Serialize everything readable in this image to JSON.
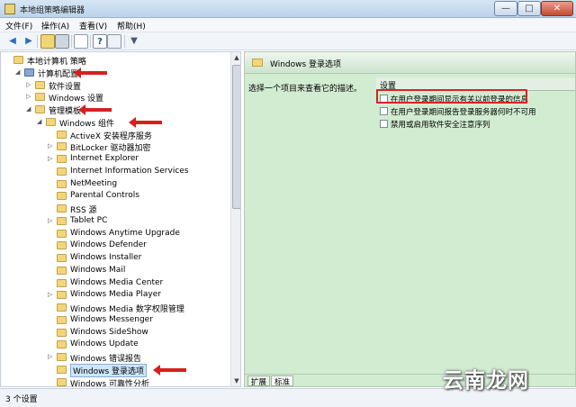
{
  "window": {
    "title": "本地组策略编辑器",
    "min_symbol": "—",
    "max_symbol": "□",
    "close_symbol": "✕"
  },
  "menu": [
    "文件(F)",
    "操作(A)",
    "查看(V)",
    "帮助(H)"
  ],
  "toolbar": {
    "back_icon": "arrow-left-icon",
    "forward_icon": "arrow-right-icon",
    "filter_symbol": "▼"
  },
  "tree": [
    {
      "label": "本地计算机 策略",
      "indent": 0,
      "expander": "",
      "icon": "policy"
    },
    {
      "label": "计算机配置",
      "indent": 1,
      "expander": "◢",
      "icon": "computer",
      "arrow": true
    },
    {
      "label": "软件设置",
      "indent": 2,
      "expander": "▷",
      "icon": "folder"
    },
    {
      "label": "Windows 设置",
      "indent": 2,
      "expander": "▷",
      "icon": "folder"
    },
    {
      "label": "管理模板",
      "indent": 2,
      "expander": "◢",
      "icon": "folder",
      "arrow": true
    },
    {
      "label": "Windows 组件",
      "indent": 3,
      "expander": "◢",
      "icon": "folder",
      "arrow": true
    },
    {
      "label": "ActiveX 安装程序服务",
      "indent": 4,
      "expander": "",
      "icon": "folder"
    },
    {
      "label": "BitLocker 驱动器加密",
      "indent": 4,
      "expander": "▷",
      "icon": "folder"
    },
    {
      "label": "Internet Explorer",
      "indent": 4,
      "expander": "▷",
      "icon": "folder"
    },
    {
      "label": "Internet Information Services",
      "indent": 4,
      "expander": "",
      "icon": "folder"
    },
    {
      "label": "NetMeeting",
      "indent": 4,
      "expander": "",
      "icon": "folder"
    },
    {
      "label": "Parental Controls",
      "indent": 4,
      "expander": "",
      "icon": "folder"
    },
    {
      "label": "RSS 源",
      "indent": 4,
      "expander": "",
      "icon": "folder"
    },
    {
      "label": "Tablet PC",
      "indent": 4,
      "expander": "▷",
      "icon": "folder"
    },
    {
      "label": "Windows Anytime Upgrade",
      "indent": 4,
      "expander": "",
      "icon": "folder"
    },
    {
      "label": "Windows Defender",
      "indent": 4,
      "expander": "",
      "icon": "folder"
    },
    {
      "label": "Windows Installer",
      "indent": 4,
      "expander": "",
      "icon": "folder"
    },
    {
      "label": "Windows Mail",
      "indent": 4,
      "expander": "",
      "icon": "folder"
    },
    {
      "label": "Windows Media Center",
      "indent": 4,
      "expander": "",
      "icon": "folder"
    },
    {
      "label": "Windows Media Player",
      "indent": 4,
      "expander": "▷",
      "icon": "folder"
    },
    {
      "label": "Windows Media 数字权限管理",
      "indent": 4,
      "expander": "",
      "icon": "folder"
    },
    {
      "label": "Windows Messenger",
      "indent": 4,
      "expander": "",
      "icon": "folder"
    },
    {
      "label": "Windows SideShow",
      "indent": 4,
      "expander": "",
      "icon": "folder"
    },
    {
      "label": "Windows Update",
      "indent": 4,
      "expander": "",
      "icon": "folder"
    },
    {
      "label": "Windows 错误报告",
      "indent": 4,
      "expander": "▷",
      "icon": "folder"
    },
    {
      "label": "Windows 登录选项",
      "indent": 4,
      "expander": "",
      "icon": "folder",
      "selected": true,
      "arrow": true
    },
    {
      "label": "Windows 可靠性分析",
      "indent": 4,
      "expander": "",
      "icon": "folder"
    }
  ],
  "right": {
    "header_title": "Windows 登录选项",
    "description": "选择一个项目来查看它的描述。",
    "column_header": "设置",
    "settings": [
      "在用户登录期间显示有关以前登录的信息",
      "在用户登录期间报告登录服务器何时不可用",
      "禁用或启用软件安全注意序列"
    ],
    "tabs": [
      "扩展",
      "标准"
    ]
  },
  "status": "3 个设置",
  "watermark": "云南龙网",
  "colors": {
    "highlight_red": "#d8241f",
    "arrow_red": "#d62020",
    "right_pane_bg": "#d2ecd2"
  }
}
